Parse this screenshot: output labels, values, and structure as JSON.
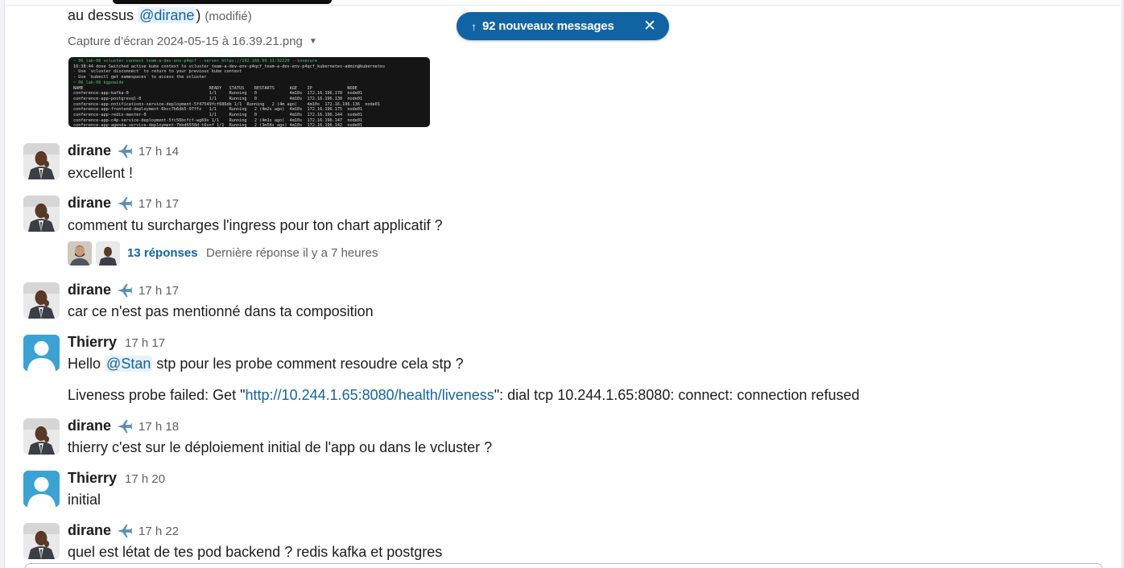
{
  "top_message": {
    "text_prefix": "au dessus",
    "mention": "@dirane",
    "closing_paren": ")",
    "edited_label": "(modifié)",
    "file_name": "Capture d’écran 2024-05-15 à 16.39.21.png",
    "file_menu_icon": "caret-down-icon",
    "screenshot_lines": [
      "~ 06_lab-06 vcluster connect team-a-dev-env-p4qcf --server https://192.168.99.11:32220 --insecure",
      "16:38:44 done Switched active kube context to vcluster_team-a-dev-env-p4qcf_team-a-dev-env-p4qcf_kubernetes-admin@kubernetes",
      "- Use `vcluster disconnect` to return to your previous kube context",
      "- Use `kubectl get namespaces` to access the vcluster",
      "~ 06_lab-06 kgpowide",
      "NAME                                                  READY   STATUS    RESTARTS      AGE    IP              NODE",
      "conference-app-kafka-0                                1/1     Running   0             4m10s  172.16.196.178  node01",
      "conference-app-postgresql-0                           1/1     Running   0             4m10s  172.16.196.138  node01",
      "conference-app-notifications-service-deployment-5f47549fcf686db 1/1  Running   2 (4m ago)    4m10s  172.16.196.136  node01",
      "conference-app-frontend-deployment-6bcc7b6db5-97ffz   1/1     Running   2 (4m2s ago)  4m10s  172.16.196.175  node01",
      "conference-app-redis-master-0                         1/1     Running   0             4m10s  172.16.196.144  node01",
      "conference-app-c4p-service-deployment-5fc56bcfcf-wg69s 1/1    Running   2 (4m1s ago)  4m10s  172.16.196.147  node01",
      "conference-app-agenda-service-deployment-7bbd6558d-t6vnf 1/1  Running   2 (3m58s ago) 4m10s  172.16.196.142  node01"
    ]
  },
  "new_messages_banner": {
    "arrow": "↑",
    "label": "92 nouveaux messages",
    "close": "✕"
  },
  "messages": [
    {
      "author": "dirane",
      "time": "17 h 14",
      "text": "excellent !"
    },
    {
      "author": "dirane",
      "time": "17 h 17",
      "text": "comment tu surcharges l'ingress pour ton chart applicatif ?",
      "thread": {
        "replies": "13 réponses",
        "last_reply": "Dernière réponse il y a 7 heures"
      }
    },
    {
      "author": "dirane",
      "time": "17 h 17",
      "text": "car ce n'est pas mentionné dans ta composition"
    },
    {
      "author": "Thierry",
      "time": "17 h 17",
      "text_prefix": "Hello",
      "mention": "@Stan",
      "text_suffix": "stp pour les probe comment resoudre cela stp ?",
      "line2_prefix": "Liveness probe failed: Get \"",
      "line2_link": "http://10.244.1.65:8080/health/liveness",
      "line2_suffix": "\": dial tcp 10.244.1.65:8080: connect: connection refused"
    },
    {
      "author": "dirane",
      "time": "17 h 18",
      "text": "thierry c'est sur le déploiement initial de l'app ou dans le vcluster ?"
    },
    {
      "author": "Thierry",
      "time": "17 h 20",
      "text": "initial"
    },
    {
      "author": "dirane",
      "time": "17 h 22",
      "text": "quel est létat de tes pod backend ? redis kafka et postgres"
    }
  ],
  "colors": {
    "banner": "#1164a3",
    "link": "#1264a3",
    "mention_bg": "#e8f2fa",
    "muted": "#616061"
  }
}
